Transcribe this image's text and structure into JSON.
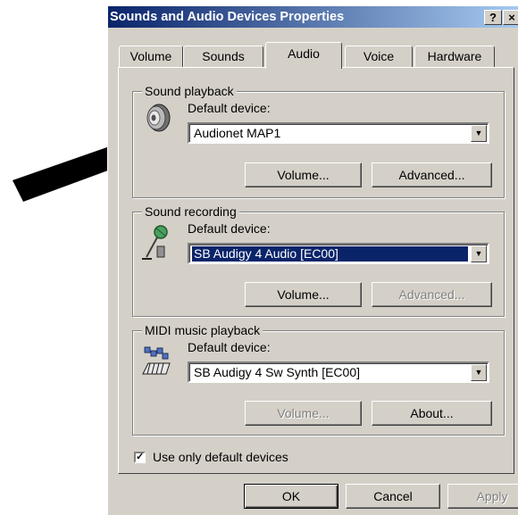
{
  "window": {
    "title": "Sounds and Audio Devices Properties",
    "help_btn": "?",
    "close_btn": "×"
  },
  "tabs": [
    {
      "label": "Volume",
      "active": false
    },
    {
      "label": "Sounds",
      "active": false
    },
    {
      "label": "Audio",
      "active": true
    },
    {
      "label": "Voice",
      "active": false
    },
    {
      "label": "Hardware",
      "active": false
    }
  ],
  "playback": {
    "group_title": "Sound playback",
    "label": "Default device:",
    "device": "Audionet MAP1",
    "volume_btn": "Volume...",
    "advanced_btn": "Advanced...",
    "icon": "speaker-icon"
  },
  "recording": {
    "group_title": "Sound recording",
    "label": "Default device:",
    "device": "SB Audigy 4 Audio [EC00]",
    "volume_btn": "Volume...",
    "advanced_btn": "Advanced...",
    "icon": "microphone-icon"
  },
  "midi": {
    "group_title": "MIDI music playback",
    "label": "Default device:",
    "device": "SB Audigy 4 Sw Synth [EC00]",
    "volume_btn": "Volume...",
    "about_btn": "About...",
    "icon": "midi-keyboard-icon"
  },
  "options": {
    "use_default_label": "Use only default devices",
    "use_default_checked": true
  },
  "footer": {
    "ok": "OK",
    "cancel": "Cancel",
    "apply": "Apply"
  },
  "colors": {
    "title_gradient_start": "#0a246a",
    "title_gradient_end": "#a6caf0",
    "face": "#d4d0c8",
    "selection": "#0a246a"
  }
}
